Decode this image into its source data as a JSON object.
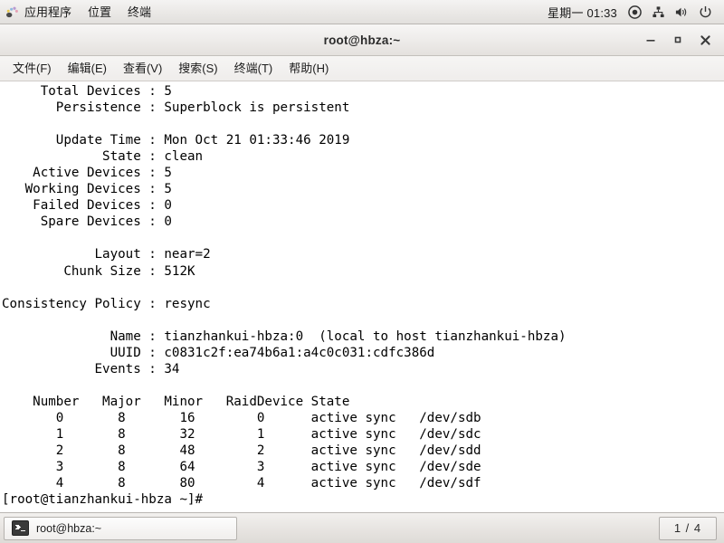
{
  "top_panel": {
    "apps_icon": "gnome-applications-icon",
    "menus": [
      {
        "label": "应用程序",
        "name": "applications-menu"
      },
      {
        "label": "位置",
        "name": "places-menu"
      },
      {
        "label": "终端",
        "name": "terminal-menu"
      }
    ],
    "clock": "星期一 01:33",
    "tray": [
      {
        "name": "record-indicator-icon"
      },
      {
        "name": "network-icon"
      },
      {
        "name": "volume-icon"
      },
      {
        "name": "power-icon"
      }
    ]
  },
  "window": {
    "title": "root@hbza:~",
    "buttons": {
      "minimize": "—",
      "maximize": "▫",
      "close": "✕"
    },
    "menu_items": [
      "文件(F)",
      "编辑(E)",
      "查看(V)",
      "搜索(S)",
      "终端(T)",
      "帮助(H)"
    ]
  },
  "terminal": {
    "details": {
      "total_devices_label": "Total Devices",
      "total_devices": "5",
      "persistence_label": "Persistence",
      "persistence": "Superblock is persistent",
      "update_time_label": "Update Time",
      "update_time": "Mon Oct 21 01:33:46 2019",
      "state_label": "State",
      "state": "clean",
      "active_devices_label": "Active Devices",
      "active_devices": "5",
      "working_devices_label": "Working Devices",
      "working_devices": "5",
      "failed_devices_label": "Failed Devices",
      "failed_devices": "0",
      "spare_devices_label": "Spare Devices",
      "spare_devices": "0",
      "layout_label": "Layout",
      "layout": "near=2",
      "chunk_size_label": "Chunk Size",
      "chunk_size": "512K",
      "consistency_policy_label": "Consistency Policy",
      "consistency_policy": "resync",
      "name_label": "Name",
      "name": "tianzhankui-hbza:0  (local to host tianzhankui-hbza)",
      "uuid_label": "UUID",
      "uuid": "c0831c2f:ea74b6a1:a4c0c031:cdfc386d",
      "events_label": "Events",
      "events": "34"
    },
    "device_table": {
      "headers": [
        "Number",
        "Major",
        "Minor",
        "RaidDevice",
        "State"
      ],
      "rows": [
        {
          "number": "0",
          "major": "8",
          "minor": "16",
          "raid_device": "0",
          "state": "active sync",
          "device": "/dev/sdb"
        },
        {
          "number": "1",
          "major": "8",
          "minor": "32",
          "raid_device": "1",
          "state": "active sync",
          "device": "/dev/sdc"
        },
        {
          "number": "2",
          "major": "8",
          "minor": "48",
          "raid_device": "2",
          "state": "active sync",
          "device": "/dev/sdd"
        },
        {
          "number": "3",
          "major": "8",
          "minor": "64",
          "raid_device": "3",
          "state": "active sync",
          "device": "/dev/sde"
        },
        {
          "number": "4",
          "major": "8",
          "minor": "80",
          "raid_device": "4",
          "state": "active sync",
          "device": "/dev/sdf"
        }
      ]
    },
    "prompt": "[root@tianzhankui-hbza ~]#",
    "screen_text": "     Total Devices : 5\n       Persistence : Superblock is persistent\n\n       Update Time : Mon Oct 21 01:33:46 2019\n             State : clean\n    Active Devices : 5\n   Working Devices : 5\n    Failed Devices : 0\n     Spare Devices : 0\n\n            Layout : near=2\n        Chunk Size : 512K\n\nConsistency Policy : resync\n\n              Name : tianzhankui-hbza:0  (local to host tianzhankui-hbza)\n              UUID : c0831c2f:ea74b6a1:a4c0c031:cdfc386d\n            Events : 34\n\n    Number   Major   Minor   RaidDevice State\n       0       8       16        0      active sync   /dev/sdb\n       1       8       32        1      active sync   /dev/sdc\n       2       8       48        2      active sync   /dev/sdd\n       3       8       64        3      active sync   /dev/sde\n       4       8       80        4      active sync   /dev/sdf\n[root@tianzhankui-hbza ~]# "
  },
  "bottom_panel": {
    "task_label": "root@hbza:~",
    "task_icon": "terminal-icon",
    "workspace": "1 / 4"
  },
  "colors": {
    "panel_bg": "#e8e5e2",
    "terminal_bg": "#ffffff",
    "terminal_fg": "#000000",
    "title_bg": "#eeecea"
  }
}
